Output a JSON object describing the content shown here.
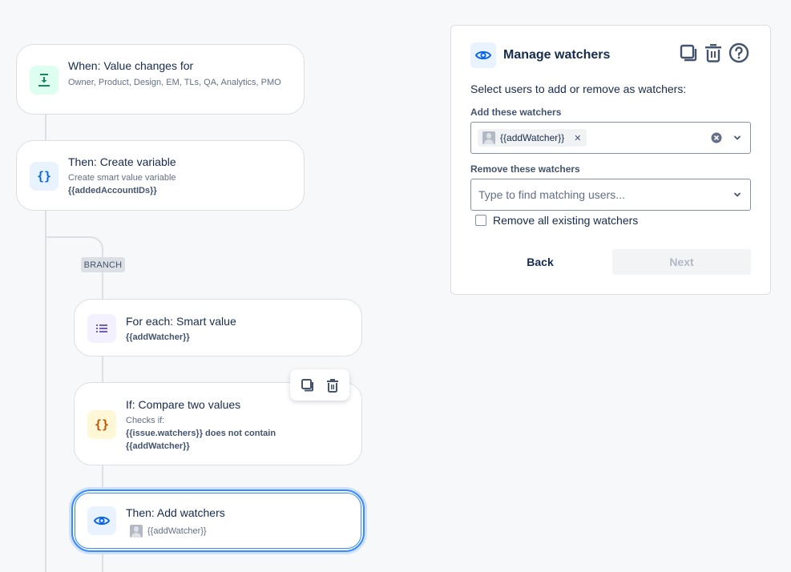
{
  "flow": {
    "nodes": [
      {
        "kind": "trigger",
        "title": "When: Value changes for",
        "subtitle": "Owner, Product, Design, EM, TLs, QA, Analytics, PMO",
        "icon": "download-arrow-icon",
        "icon_color": "#1f845a",
        "icon_bg": "#dcfff1"
      },
      {
        "kind": "action",
        "title": "Then: Create variable",
        "subtitle": "Create smart value variable",
        "value": "{{addedAccountIDs}}",
        "icon": "curly-braces-icon",
        "icon_color": "#0c66e4",
        "icon_bg": "#e9f2ff"
      },
      {
        "kind": "branch",
        "label": "BRANCH"
      },
      {
        "kind": "branch-rule",
        "title": "For each: Smart value",
        "value": "{{addWatcher}}",
        "icon": "list-icon",
        "icon_color": "#6e5dc6",
        "icon_bg": "#f3f0ff"
      },
      {
        "kind": "condition",
        "title": "If: Compare two values",
        "subtitle": "Checks if:",
        "value_line1": "{{issue.watchers}} does not contain",
        "value_line2": "{{addWatcher}}",
        "icon": "curly-braces-icon",
        "icon_color": "#c25100",
        "icon_bg": "#fff7d6"
      },
      {
        "kind": "action",
        "title": "Then: Add watchers",
        "value": "{{addWatcher}}",
        "icon": "eye-icon",
        "icon_color": "#0c66e4",
        "icon_bg": "#e9f2ff",
        "selected": true
      }
    ],
    "node_toolbar": {
      "duplicate_icon": "duplicate-icon",
      "delete_icon": "trash-icon"
    }
  },
  "panel": {
    "title": "Manage watchers",
    "icon": "eye-icon",
    "actions": [
      "duplicate-icon",
      "trash-icon",
      "help-icon"
    ],
    "description": "Select users to add or remove as watchers:",
    "add_label": "Add these watchers",
    "add_selected": [
      {
        "label": "{{addWatcher}}"
      }
    ],
    "remove_label": "Remove these watchers",
    "remove_placeholder": "Type to find matching users...",
    "remove_all_label": "Remove all existing watchers",
    "remove_all_checked": false,
    "back_label": "Back",
    "next_label": "Next",
    "accent_color": "#388bff"
  }
}
